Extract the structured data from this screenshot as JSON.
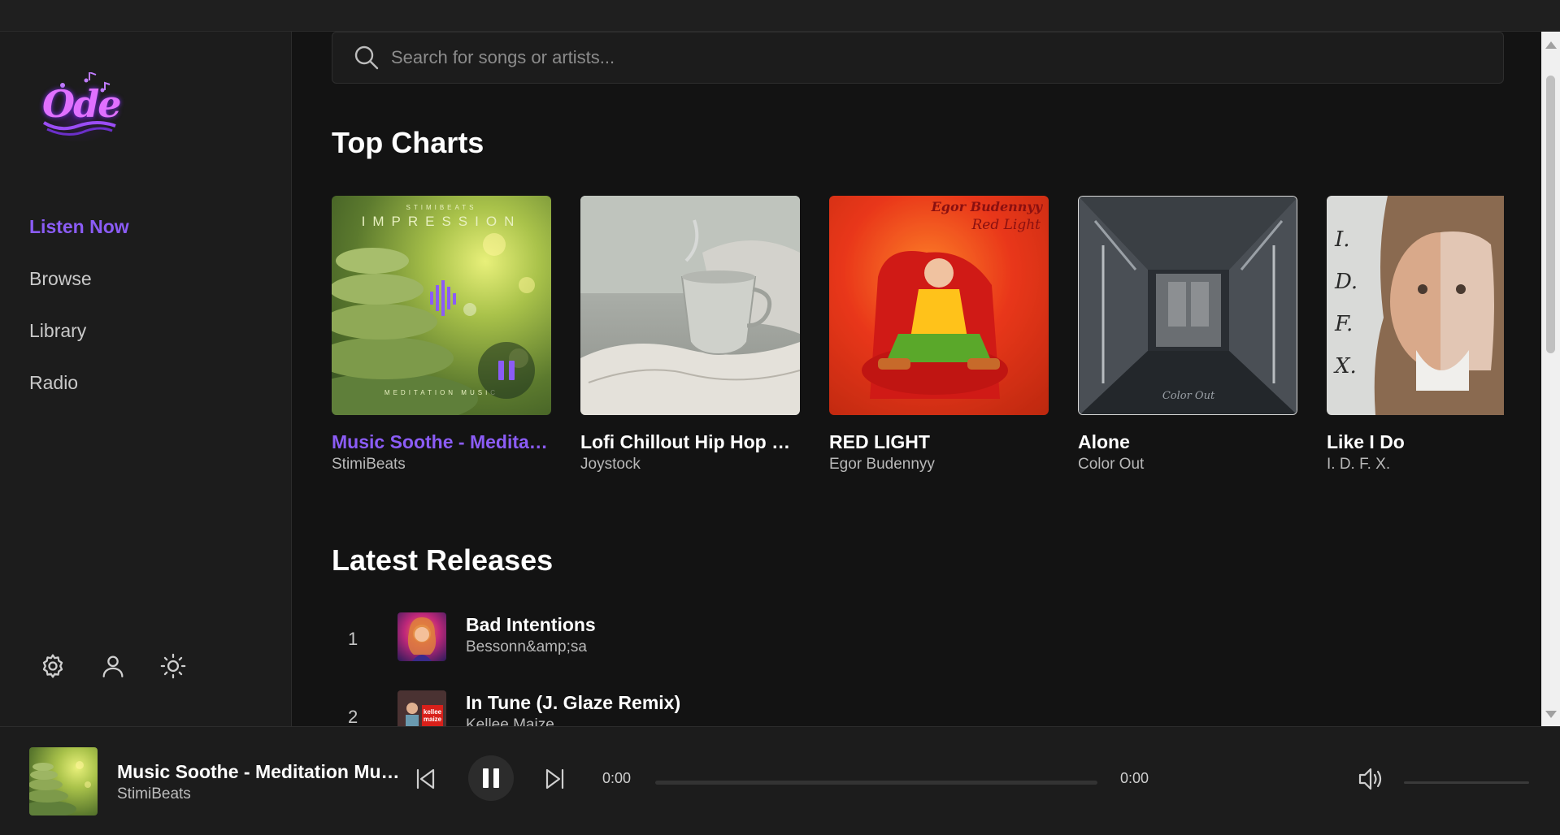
{
  "app": {
    "name": "Ode"
  },
  "sidebar": {
    "nav": [
      {
        "label": "Listen Now",
        "active": true
      },
      {
        "label": "Browse",
        "active": false
      },
      {
        "label": "Library",
        "active": false
      },
      {
        "label": "Radio",
        "active": false
      }
    ],
    "bottom_icons": [
      "settings-icon",
      "user-icon",
      "theme-sun-icon"
    ]
  },
  "search": {
    "placeholder": "Search for songs or artists...",
    "value": ""
  },
  "top_charts": {
    "title": "Top Charts",
    "items": [
      {
        "title": "Music Soothe - Meditation Music",
        "artist": "StimiBeats",
        "playing": true,
        "art_text_top": "STIMIBEATS",
        "art_text_main": "IMPRESSION",
        "art_text_bottom": "MEDITATION MUSIC"
      },
      {
        "title": "Lofi Chillout Hip Hop Beats",
        "artist": "Joystock",
        "playing": false
      },
      {
        "title": "RED LIGHT",
        "artist": "Egor Budennyy",
        "playing": false,
        "art_text_top": "Egor Budennyy",
        "art_text_main": "Red Light"
      },
      {
        "title": "Alone",
        "artist": "Color Out",
        "playing": false,
        "art_text_main": "Color Out"
      },
      {
        "title": "Like I Do",
        "artist": "I. D. F. X.",
        "playing": false,
        "art_text_main": "I. D. F. X."
      }
    ]
  },
  "latest_releases": {
    "title": "Latest Releases",
    "items": [
      {
        "num": "1",
        "title": "Bad Intentions",
        "artist": "Bessonn&amp;sa"
      },
      {
        "num": "2",
        "title": "In Tune (J. Glaze Remix)",
        "artist": "Kellee Maize",
        "art_text": "kellee maize"
      }
    ]
  },
  "player": {
    "title": "Music Soothe - Meditation Music",
    "artist": "StimiBeats",
    "current_time": "0:00",
    "total_time": "0:00",
    "progress": 0,
    "volume": 0
  },
  "colors": {
    "accent": "#8b5cf6",
    "background": "#131313",
    "sidebar": "#1c1c1c"
  }
}
